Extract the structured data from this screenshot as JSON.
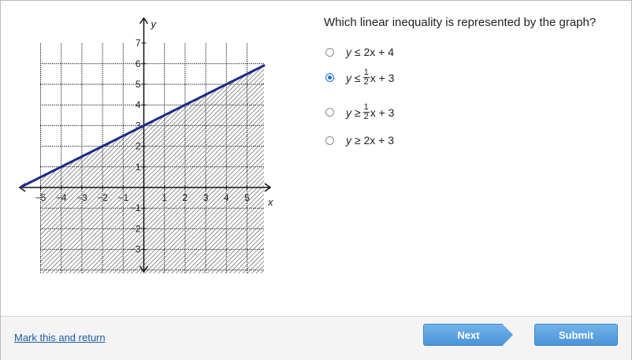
{
  "question": "Which linear inequality is represented by the graph?",
  "options": [
    {
      "var": "y",
      "op": "≤",
      "coef": "2",
      "rest": "x + 4",
      "fraction": null,
      "selected": false
    },
    {
      "var": "y",
      "op": "≤",
      "coef": "",
      "rest": "x + 3",
      "fraction": {
        "num": "1",
        "den": "2"
      },
      "selected": true
    },
    {
      "var": "y",
      "op": "≥",
      "coef": "",
      "rest": "x + 3",
      "fraction": {
        "num": "1",
        "den": "2"
      },
      "selected": false
    },
    {
      "var": "y",
      "op": "≥",
      "coef": "2",
      "rest": "x + 3",
      "fraction": null,
      "selected": false
    }
  ],
  "graph": {
    "x_label": "x",
    "y_label": "y",
    "x_ticks": [
      "−5",
      "−4",
      "−3",
      "−2",
      "−1",
      "1",
      "2",
      "3",
      "4",
      "5"
    ],
    "y_ticks_pos": [
      "1",
      "2",
      "3",
      "4",
      "5",
      "6",
      "7"
    ],
    "y_ticks_neg": [
      "−1",
      "−2",
      "−3"
    ],
    "line": {
      "slope": 0.5,
      "intercept": 3
    },
    "shading": "below",
    "x_range": [
      -6,
      6
    ],
    "y_range": [
      -4,
      7
    ],
    "colors": {
      "line": "#1b2a8c",
      "hatch": "#555555",
      "grid": "#333333"
    }
  },
  "footer": {
    "mark_link": "Mark this and return",
    "next": "Next",
    "submit": "Submit"
  }
}
